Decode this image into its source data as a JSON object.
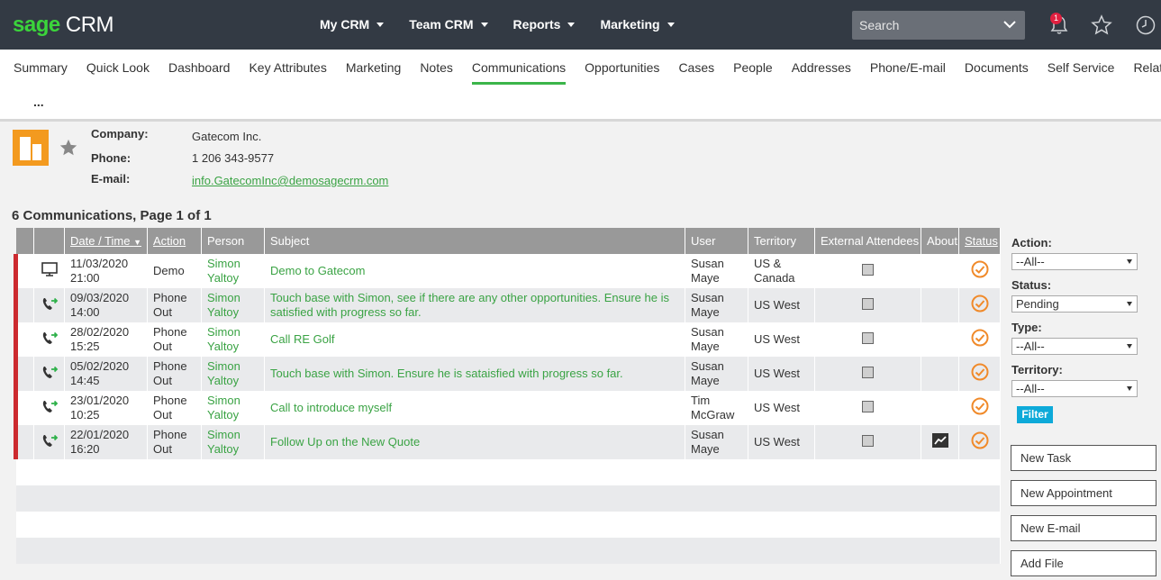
{
  "app": {
    "logo_sage": "sage",
    "logo_crm": "CRM"
  },
  "topnav": [
    "My CRM",
    "Team CRM",
    "Reports",
    "Marketing"
  ],
  "search": {
    "placeholder": "Search"
  },
  "notifications": {
    "count": "1"
  },
  "tabs": [
    "Summary",
    "Quick Look",
    "Dashboard",
    "Key Attributes",
    "Marketing",
    "Notes",
    "Communications",
    "Opportunities",
    "Cases",
    "People",
    "Addresses",
    "Phone/E-mail",
    "Documents",
    "Self Service",
    "Relat"
  ],
  "active_tab": "Communications",
  "more_label": "...",
  "company": {
    "company_label": "Company:",
    "company_value": "Gatecom Inc.",
    "phone_label": "Phone:",
    "phone_value": "1 206 343-9577",
    "email_label": "E-mail:",
    "email_value": "info.GatecomInc@demosagecrm.com"
  },
  "count_text": "6 Communications, Page 1 of 1",
  "table": {
    "headers": [
      "",
      "",
      "Date / Time",
      "Action",
      "Person",
      "Subject",
      "User",
      "Territory",
      "External Attendees",
      "About",
      "Status"
    ],
    "rows": [
      {
        "icon": "monitor-icon",
        "date": "11/03/2020",
        "time": "21:00",
        "action": "Demo",
        "person_first": "Simon",
        "person_last": "Yaltoy",
        "subject": "Demo to Gatecom",
        "user_first": "Susan",
        "user_last": "Maye",
        "territory": "US & Canada",
        "about": ""
      },
      {
        "icon": "phone-out-icon",
        "date": "09/03/2020",
        "time": "14:00",
        "action": "Phone Out",
        "person_first": "Simon",
        "person_last": "Yaltoy",
        "subject": "Touch base with Simon, see if there are any other opportunities. Ensure he is satisfied with progress so far.",
        "user_first": "Susan",
        "user_last": "Maye",
        "territory": "US West",
        "about": ""
      },
      {
        "icon": "phone-out-icon",
        "date": "28/02/2020",
        "time": "15:25",
        "action": "Phone Out",
        "person_first": "Simon",
        "person_last": "Yaltoy",
        "subject": "Call RE Golf",
        "user_first": "Susan",
        "user_last": "Maye",
        "territory": "US West",
        "about": ""
      },
      {
        "icon": "phone-out-icon",
        "date": "05/02/2020",
        "time": "14:45",
        "action": "Phone Out",
        "person_first": "Simon",
        "person_last": "Yaltoy",
        "subject": "Touch base with Simon. Ensure he is sataisfied with progress so far.",
        "user_first": "Susan",
        "user_last": "Maye",
        "territory": "US West",
        "about": ""
      },
      {
        "icon": "phone-out-icon",
        "date": "23/01/2020",
        "time": "10:25",
        "action": "Phone Out",
        "person_first": "Simon",
        "person_last": "Yaltoy",
        "subject": "Call to introduce myself",
        "user_first": "Tim",
        "user_last": "McGraw",
        "territory": "US West",
        "about": ""
      },
      {
        "icon": "phone-out-icon",
        "date": "22/01/2020",
        "time": "16:20",
        "action": "Phone Out",
        "person_first": "Simon",
        "person_last": "Yaltoy",
        "subject": "Follow Up on the New Quote",
        "user_first": "Susan",
        "user_last": "Maye",
        "territory": "US West",
        "about": "opportunity-icon"
      }
    ]
  },
  "filters": {
    "action_label": "Action:",
    "action_value": "--All--",
    "status_label": "Status:",
    "status_value": "Pending",
    "type_label": "Type:",
    "type_value": "--All--",
    "territory_label": "Territory:",
    "territory_value": "--All--",
    "filter_button": "Filter"
  },
  "actions": [
    "New Task",
    "New Appointment",
    "New E-mail",
    "Add File"
  ],
  "colors": {
    "topbar": "#333a44",
    "accent_green": "#3bb54a",
    "link_green": "#3aa344",
    "row_flag": "#cc2a2f",
    "filter_button": "#0eaad9",
    "company_icon": "#f39a1f",
    "status_icon": "#f08a2a"
  }
}
